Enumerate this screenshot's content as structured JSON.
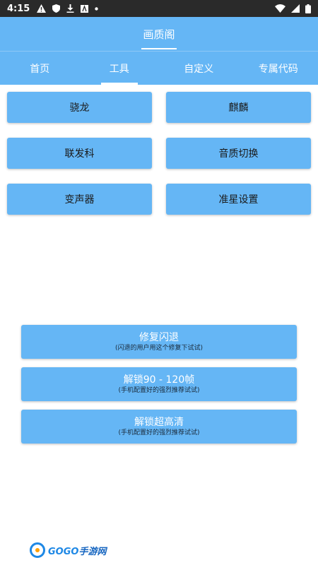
{
  "status_bar": {
    "time": "4:15",
    "icons_left": [
      "warning-icon",
      "shield-icon",
      "download-icon",
      "a-box-icon",
      "dot-icon"
    ],
    "icons_right": [
      "wifi-icon",
      "signal-icon",
      "battery-icon"
    ]
  },
  "header": {
    "title": "画质阁"
  },
  "tabs": [
    {
      "label": "首页"
    },
    {
      "label": "工具"
    },
    {
      "label": "自定义"
    },
    {
      "label": "专属代码"
    }
  ],
  "grid_buttons": [
    {
      "label": "骁龙"
    },
    {
      "label": "麒麟"
    },
    {
      "label": "联发科"
    },
    {
      "label": "音质切换"
    },
    {
      "label": "变声器"
    },
    {
      "label": "准星设置"
    }
  ],
  "action_buttons": [
    {
      "title": "修复闪退",
      "subtitle": "(闪退的用户用这个修复下试试)"
    },
    {
      "title": "解锁90 - 120帧",
      "subtitle": "(手机配置好的强烈推荐试试)"
    },
    {
      "title": "解锁超高清",
      "subtitle": "(手机配置好的强烈推荐试试)"
    }
  ],
  "watermark": {
    "brand": "GOGO",
    "brand_cn": "手游网"
  },
  "colors": {
    "accent": "#65b6f5",
    "status_bar": "#2a2a2a"
  }
}
